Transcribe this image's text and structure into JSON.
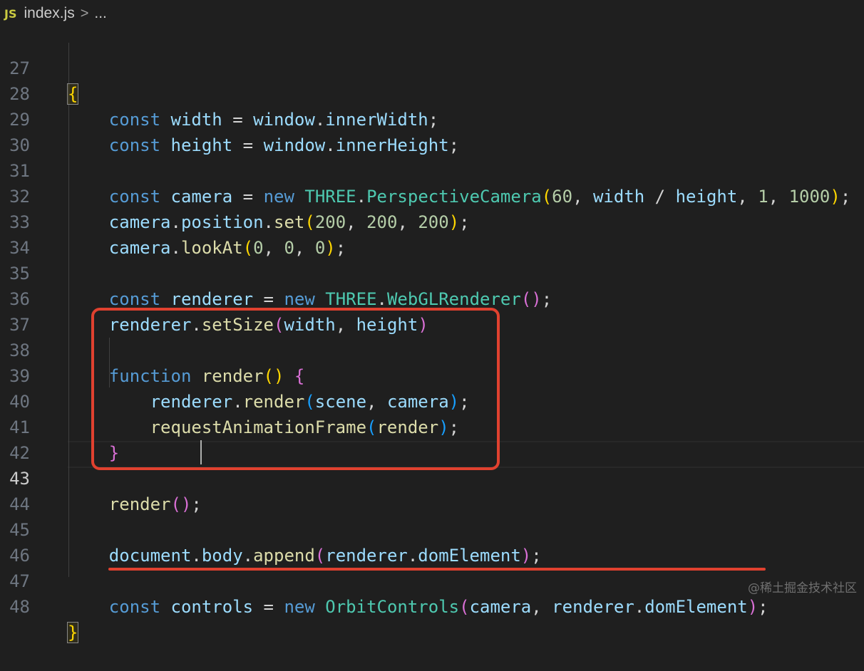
{
  "breadcrumb": {
    "file_icon": "JS",
    "file_name": "index.js",
    "separator": ">",
    "more": "..."
  },
  "editor": {
    "active_line": 43,
    "lines": [
      {
        "n": "27",
        "text": "{"
      },
      {
        "n": "28",
        "text": "    const width = window.innerWidth;"
      },
      {
        "n": "29",
        "text": "    const height = window.innerHeight;"
      },
      {
        "n": "30",
        "text": ""
      },
      {
        "n": "31",
        "text": "    const camera = new THREE.PerspectiveCamera(60, width / height, 1, 1000);"
      },
      {
        "n": "32",
        "text": "    camera.position.set(200, 200, 200);"
      },
      {
        "n": "33",
        "text": "    camera.lookAt(0, 0, 0);"
      },
      {
        "n": "34",
        "text": ""
      },
      {
        "n": "35",
        "text": "    const renderer = new THREE.WebGLRenderer();"
      },
      {
        "n": "36",
        "text": "    renderer.setSize(width, height)"
      },
      {
        "n": "37",
        "text": ""
      },
      {
        "n": "38",
        "text": "    function render() {"
      },
      {
        "n": "39",
        "text": "        renderer.render(scene, camera);"
      },
      {
        "n": "40",
        "text": "        requestAnimationFrame(render);"
      },
      {
        "n": "41",
        "text": "    }"
      },
      {
        "n": "42",
        "text": ""
      },
      {
        "n": "43",
        "text": "    render();"
      },
      {
        "n": "44",
        "text": ""
      },
      {
        "n": "45",
        "text": "    document.body.append(renderer.domElement);"
      },
      {
        "n": "46",
        "text": ""
      },
      {
        "n": "47",
        "text": "    const controls = new OrbitControls(camera, renderer.domElement);"
      },
      {
        "n": "48",
        "text": "}"
      }
    ]
  },
  "annotations": {
    "highlight_color": "#e0412f"
  },
  "watermark": "@稀土掘金技术社区"
}
